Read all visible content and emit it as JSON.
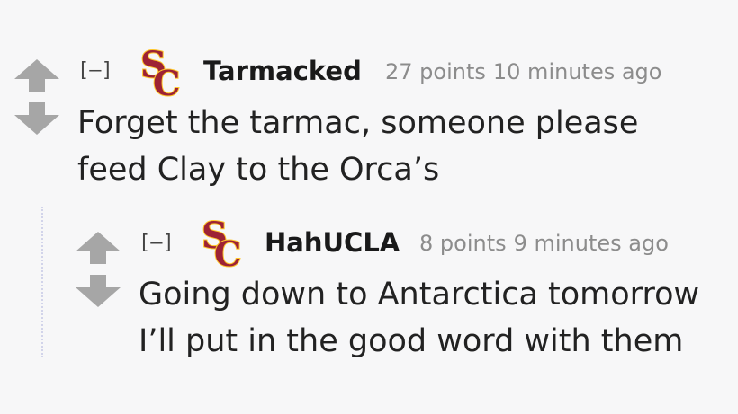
{
  "comments": [
    {
      "collapse_label": "[–]",
      "author": "Tarmacked",
      "score": "27 points",
      "time": "10 minutes ago",
      "body_lines": [
        "Forget the tarmac, someone please",
        "feed Clay to the Orca’s"
      ],
      "flair_icon": "usc-sc-logo-icon",
      "flair_letters": "SC"
    },
    {
      "collapse_label": "[–]",
      "author": "HahUCLA",
      "score": "8 points",
      "time": "9 minutes ago",
      "body_lines": [
        "Going down to Antarctica tomorrow",
        "I’ll put in the good word with them"
      ],
      "flair_icon": "usc-sc-logo-icon",
      "flair_letters": "SC"
    }
  ],
  "colors": {
    "arrow": "#a6a6a6",
    "flair_red": "#9d2235",
    "flair_gold": "#ffc72c",
    "thread_line": "#d2d4ea",
    "meta_text": "#8c8c8c",
    "body_text": "#222222"
  }
}
